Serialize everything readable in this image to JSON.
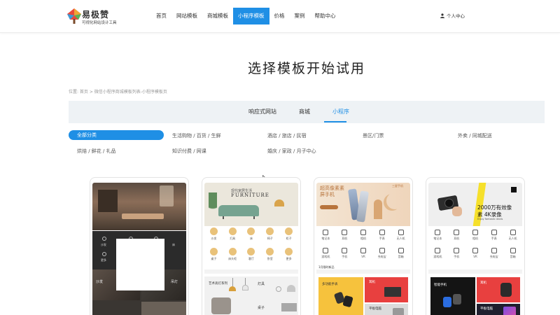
{
  "header": {
    "logo_title": "易极赞",
    "logo_subtitle": "可视化网站设计工具",
    "nav": [
      "首页",
      "网站模板",
      "商城模板",
      "小程序模板",
      "价格",
      "案例",
      "帮助中心"
    ],
    "active_nav": "小程序模板",
    "user_center": "个人中心"
  },
  "main": {
    "page_title": "选择模板开始试用",
    "breadcrumb": "位置: 首页 > 微信小程序商城模板列表-小程序模板页",
    "tabs": [
      "响应式网站",
      "商城",
      "小程序"
    ],
    "active_tab": "小程序",
    "filters": [
      "全部分类",
      "生活购物 / 百货 / 生鲜",
      "酒店 / 旅店 / 民宿",
      "景区/门票",
      "外卖 / 同城配送",
      "烘焙 / 鲜花 / 礼品",
      "知识付费 / 网课",
      "婚庆 / 家政 / 月子中心"
    ],
    "active_filter": "全部分类"
  },
  "colors": {
    "accent": "#1f8fe5",
    "tab_bar_bg": "#eef2f5"
  },
  "templates": [
    {
      "name": "furniture-dark",
      "icon_labels": [
        "沙发",
        "餐椅",
        "吊灯",
        "床",
        "更多"
      ],
      "section_labels": [
        "沙发",
        "吊灯"
      ]
    },
    {
      "name": "furniture-light",
      "banner_small": "现代家居生活",
      "banner_title": "FURNITURE",
      "icon_labels": [
        "沙发",
        "灯具",
        "床",
        "椅子",
        "柜子",
        "桌子",
        "床头柜",
        "客厅",
        "卧室",
        "更多"
      ],
      "section_labels": [
        "艺术高灯系列",
        "灯具",
        "桌子"
      ]
    },
    {
      "name": "digital-warm",
      "banner_line1": "超高像素素",
      "banner_line2": "屏手机",
      "banner_tag": "三星手机",
      "icon_labels": [
        "笔记本",
        "耳机",
        "相机",
        "手表",
        "无人机",
        "游戏机",
        "手机",
        "VR",
        "充电宝",
        "音箱"
      ],
      "notice": "1月限时新品",
      "promo_labels": [
        "多功能手表",
        "耳机",
        "平板电脑"
      ]
    },
    {
      "name": "digital-camera",
      "banner_line1": "2000万有效像",
      "banner_line2": "素 4K录像",
      "banner_small": "Enjoy fantastic deals",
      "icon_labels": [
        "笔记本",
        "耳机",
        "相机",
        "手表",
        "无人机",
        "游戏机",
        "手机",
        "VR",
        "充电宝",
        "音箱"
      ],
      "promo_labels": [
        "智能手机",
        "耳机",
        "平板电脑"
      ]
    }
  ]
}
